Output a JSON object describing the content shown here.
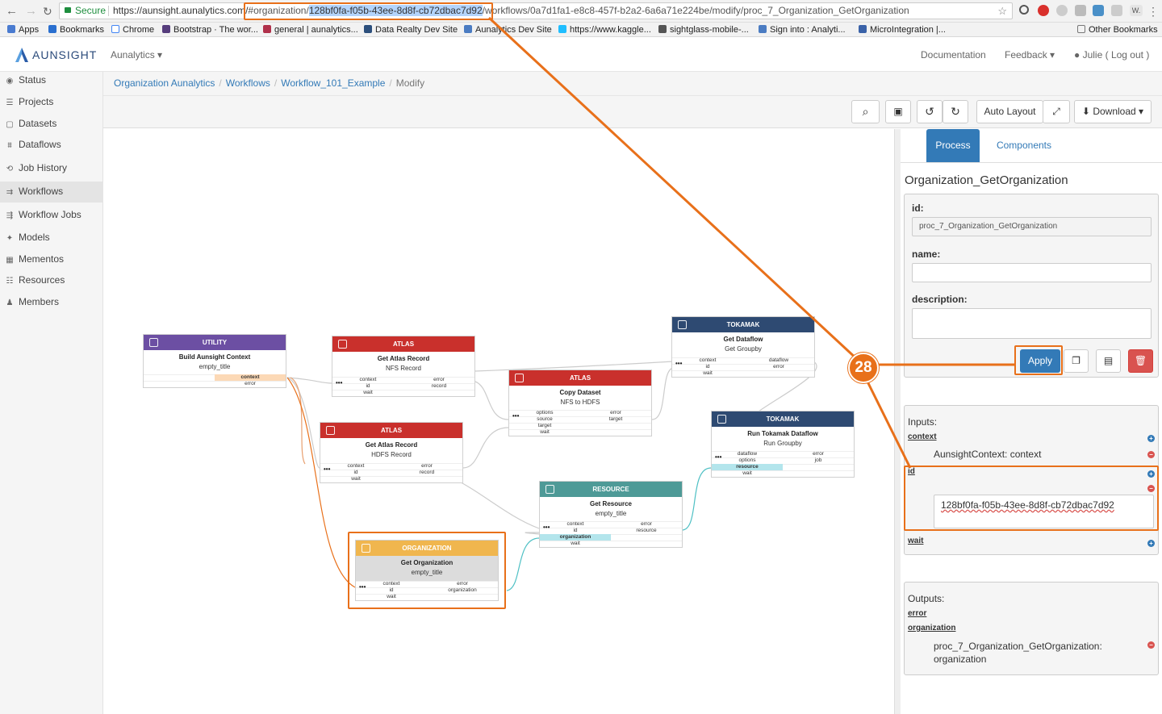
{
  "browser": {
    "secure_label": "Secure",
    "url_prefix": "https://aunsight.aunalytics.com/",
    "url_hash_org": "#organization/",
    "url_org_id": "128bf0fa-f05b-43ee-8d8f-cb72dbac7d92",
    "url_rest": "/workflows/0a7d1fa1-e8c8-457f-b2a2-6a6a71e224be/modify/proc_7_Organization_GetOrganization",
    "bookmarks": [
      {
        "label": "Apps",
        "color": "#4a7bd0"
      },
      {
        "label": "Bookmarks",
        "color": "#2a6fcf"
      },
      {
        "label": "Chrome",
        "color": "#ffffff"
      },
      {
        "label": "Bootstrap · The wor...",
        "color": "#563d7c"
      },
      {
        "label": "general | aunalytics...",
        "color": "#b0314b"
      },
      {
        "label": "Data Realty Dev Site",
        "color": "#2c4f7c"
      },
      {
        "label": "Aunalytics Dev Site",
        "color": "#4b7cc2"
      },
      {
        "label": "https://www.kaggle...",
        "color": "#20beff"
      },
      {
        "label": "sightglass-mobile-...",
        "color": "#555555"
      },
      {
        "label": "Sign into : Analyti...",
        "color": "#4b7cc2"
      },
      {
        "label": "MicroIntegration |...",
        "color": "#3a62a8"
      }
    ],
    "other_bookmarks": "Other Bookmarks"
  },
  "app": {
    "logo": "AUNSIGHT",
    "menu_label": "Aunalytics",
    "documentation": "Documentation",
    "feedback": "Feedback",
    "user": "Julie",
    "logout": "( Log out )"
  },
  "sidebar": {
    "items": [
      {
        "label": "Status",
        "icon": "dashboard-icon"
      },
      {
        "label": "Projects",
        "icon": "list-icon"
      },
      {
        "label": "Datasets",
        "icon": "file-icon"
      },
      {
        "label": "Dataflows",
        "icon": "sitemap-icon"
      },
      {
        "label": "Job History",
        "icon": "job-history-icon"
      },
      {
        "label": "Workflows",
        "icon": "workflow-icon"
      },
      {
        "label": "Workflow Jobs",
        "icon": "workflow-jobs-icon"
      },
      {
        "label": "Models",
        "icon": "model-icon"
      },
      {
        "label": "Mementos",
        "icon": "memento-icon"
      },
      {
        "label": "Resources",
        "icon": "resource-icon"
      },
      {
        "label": "Members",
        "icon": "users-icon"
      }
    ],
    "active_index": 5
  },
  "breadcrumb": {
    "items": [
      "Organization Aunalytics",
      "Workflows",
      "Workflow_101_Example"
    ],
    "current": "Modify"
  },
  "toolbar": {
    "auto_layout": "Auto Layout",
    "download": "Download"
  },
  "canvas": {
    "nodes": {
      "utility": {
        "header": "UTILITY",
        "title": "Build Aunsight Context",
        "subtitle": "empty_title",
        "out1": "context",
        "out2": "error",
        "color": "#6c4fa3"
      },
      "atlas1": {
        "header": "ATLAS",
        "title": "Get Atlas Record",
        "subtitle": "NFS Record",
        "in1": "context",
        "in2": "id",
        "in3": "wait",
        "out1": "error",
        "out2": "record",
        "color": "#c9302c"
      },
      "atlas2": {
        "header": "ATLAS",
        "title": "Copy Dataset",
        "subtitle": "NFS to HDFS",
        "in1": "options",
        "in2": "source",
        "in3": "target",
        "in4": "wait",
        "out1": "error",
        "out2": "target",
        "color": "#c9302c"
      },
      "atlas3": {
        "header": "ATLAS",
        "title": "Get Atlas Record",
        "subtitle": "HDFS Record",
        "in1": "context",
        "in2": "id",
        "in3": "wait",
        "out1": "error",
        "out2": "record",
        "color": "#c9302c"
      },
      "tokamak1": {
        "header": "TOKAMAK",
        "title": "Get Dataflow",
        "subtitle": "Get Groupby",
        "in1": "context",
        "in2": "id",
        "in3": "wait",
        "out1": "dataflow",
        "out2": "error",
        "color": "#2e4a72"
      },
      "tokamak2": {
        "header": "TOKAMAK",
        "title": "Run Tokamak Dataflow",
        "subtitle": "Run Groupby",
        "in1": "dataflow",
        "in2": "options",
        "in3": "resource",
        "in4": "wait",
        "out1": "error",
        "out2": "job",
        "color": "#2e4a72"
      },
      "resource": {
        "header": "RESOURCE",
        "title": "Get Resource",
        "subtitle": "empty_title",
        "in1": "context",
        "in2": "id",
        "in3": "organization",
        "in4": "wait",
        "out1": "error",
        "out2": "resource",
        "color": "#4e9a97"
      },
      "organization": {
        "header": "ORGANIZATION",
        "title": "Get Organization",
        "subtitle": "empty_title",
        "in1": "context",
        "in2": "id",
        "in3": "wait",
        "out1": "error",
        "out2": "organization",
        "color": "#f0b64e"
      }
    }
  },
  "panel": {
    "tab_process": "Process",
    "tab_components": "Components",
    "heading": "Organization_GetOrganization",
    "id_label": "id:",
    "id_value": "proc_7_Organization_GetOrganization",
    "name_label": "name:",
    "name_value": "",
    "description_label": "description:",
    "description_value": "",
    "apply": "Apply",
    "inputs_label": "Inputs:",
    "input_context": "context",
    "input_context_value": "AunsightContext: context",
    "input_id": "id",
    "input_id_value": "128bf0fa-f05b-43ee-8d8f-cb72dbac7d92",
    "input_wait": "wait",
    "outputs_label": "Outputs:",
    "output_error": "error",
    "output_organization": "organization",
    "output_org_value": "proc_7_Organization_GetOrganization: organization"
  },
  "annotation": {
    "step": "28",
    "color": "#e8701a"
  }
}
